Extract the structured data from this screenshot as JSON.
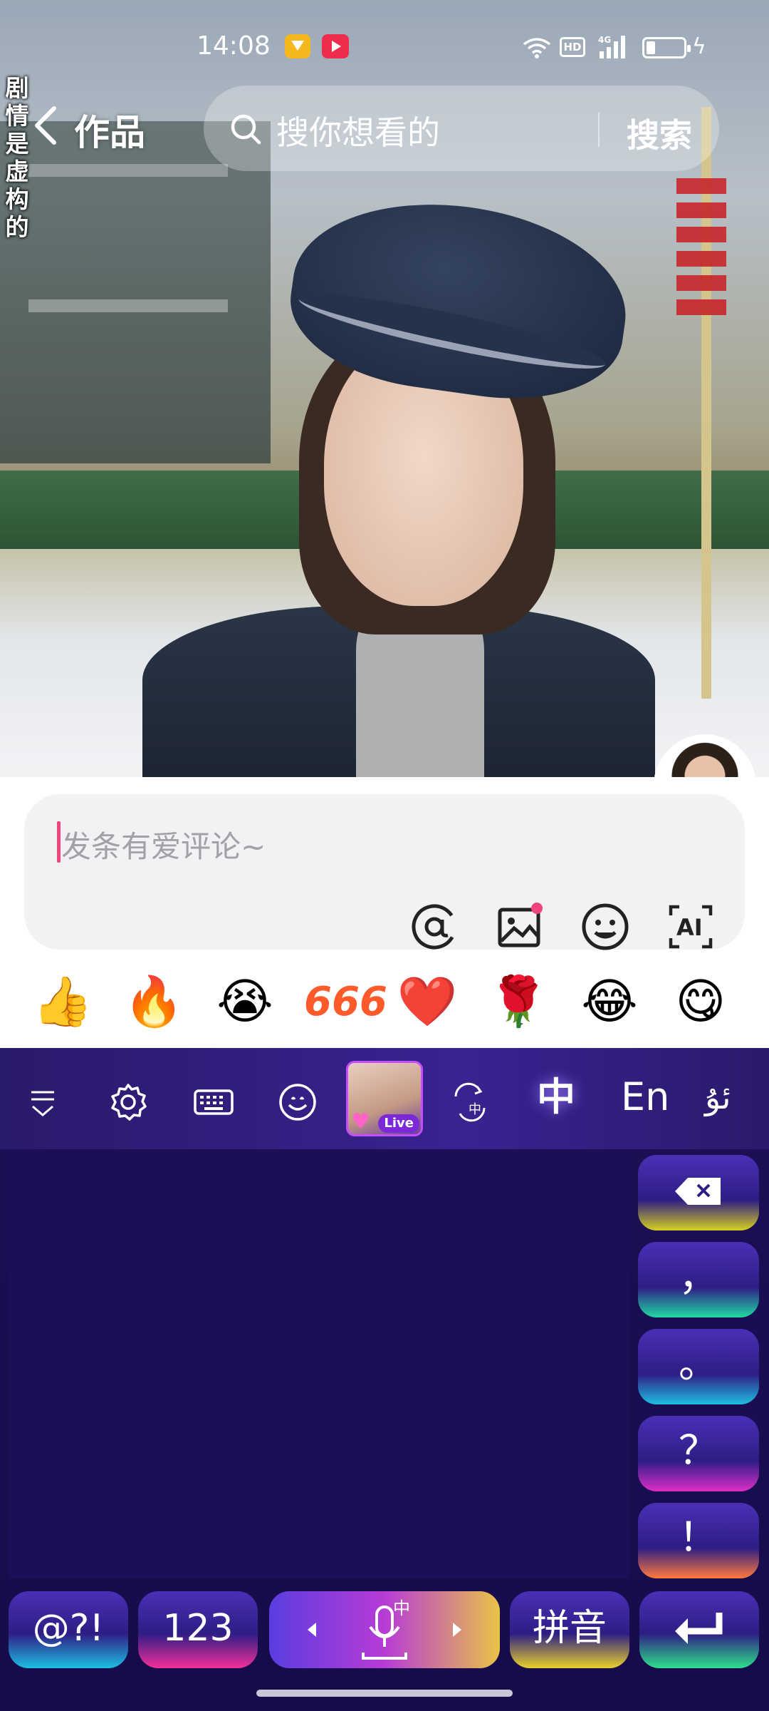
{
  "status_bar": {
    "time": "14:08",
    "network": "HD",
    "cellular": "4G"
  },
  "video": {
    "overlay_text": "剧情是虚构的"
  },
  "nav": {
    "title": "作品",
    "search_placeholder": "搜你想看的",
    "search_button": "搜索"
  },
  "comment": {
    "placeholder": "发条有爱评论~",
    "caret_color": "#f0457b",
    "tools": [
      "at-icon",
      "image-icon",
      "emoji-icon",
      "ai-icon"
    ]
  },
  "quick_emojis": [
    "👍",
    "🔥",
    "😭",
    "666",
    "❤️",
    "🌹",
    "😂",
    "😋"
  ],
  "keyboard": {
    "toolbar": {
      "live_badge": "Live",
      "lang_zh": "中",
      "lang_en": "En",
      "lang_ug": "ئۇ"
    },
    "side_keys": [
      "",
      "，",
      "。",
      "？",
      "！"
    ],
    "bottom_keys": {
      "symbols": "@?!",
      "numbers": "123",
      "voice_mode": "中",
      "pinyin": "拼音"
    }
  },
  "colors": {
    "keyboard_bg": "#160c4a",
    "toolbar_bg": "#3a2290",
    "accent_pink": "#f0457b"
  }
}
